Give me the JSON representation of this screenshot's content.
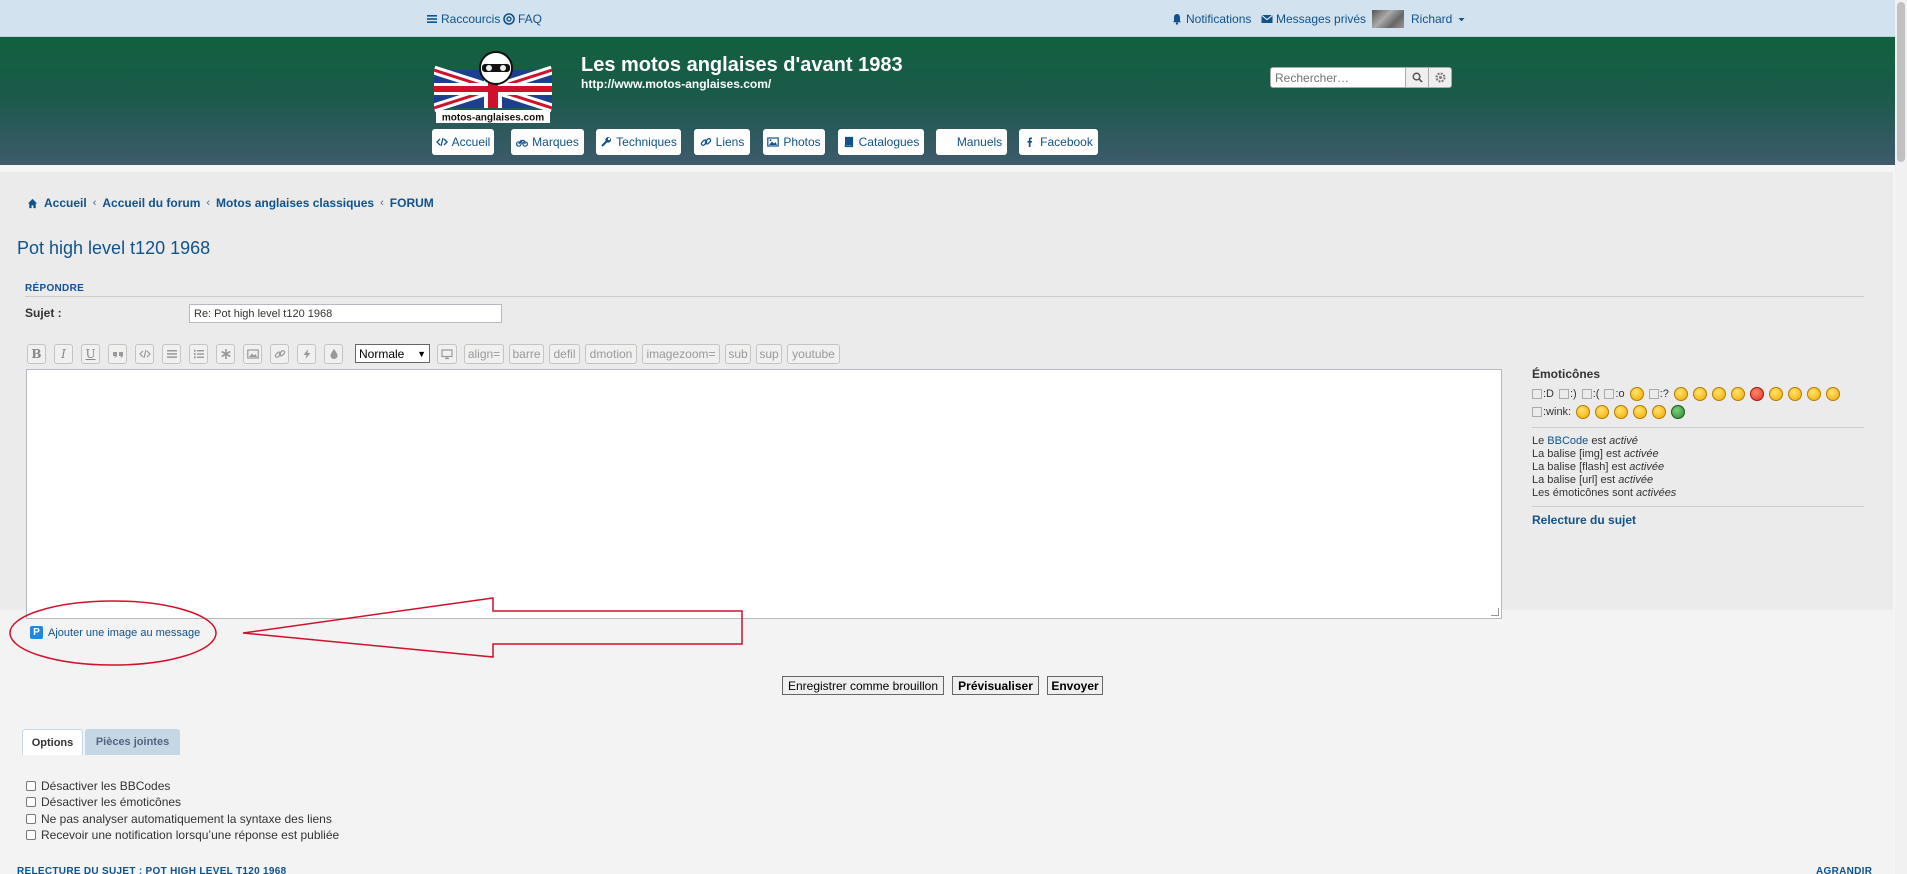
{
  "topbar": {
    "shortcuts": "Raccourcis",
    "faq": "FAQ",
    "notifications": "Notifications",
    "messages": "Messages privés",
    "user": "Richard"
  },
  "site": {
    "logo_text": "motos-anglaises.com",
    "title": "Les motos anglaises d'avant 1983",
    "url": "http://www.motos-anglaises.com/"
  },
  "search": {
    "placeholder": "Rechercher…"
  },
  "nav": [
    {
      "label": "Accueil",
      "icon": "code-icon"
    },
    {
      "label": "Marques",
      "icon": "motorcycle-icon"
    },
    {
      "label": "Techniques",
      "icon": "wrench-icon"
    },
    {
      "label": "Liens",
      "icon": "link-icon"
    },
    {
      "label": "Photos",
      "icon": "image-icon"
    },
    {
      "label": "Catalogues",
      "icon": "book-icon"
    },
    {
      "label": "Manuels",
      "icon": ""
    },
    {
      "label": "Facebook",
      "icon": "facebook-icon"
    }
  ],
  "breadcrumb": [
    "Accueil",
    "Accueil du forum",
    "Motos anglaises classiques",
    "FORUM"
  ],
  "page": {
    "title": "Pot high level t120 1968",
    "section": "RÉPONDRE",
    "subject_label": "Sujet :",
    "subject_value": "Re: Pot high level t120 1968"
  },
  "toolbar": {
    "bold": "B",
    "italic": "I",
    "underline": "U",
    "size_select": "Normale",
    "custom": [
      "align=",
      "barre",
      "defil",
      "dmotion",
      "imagezoom=",
      "sub",
      "sup",
      "youtube"
    ]
  },
  "smilies": {
    "heading": "Émoticônes",
    "broken": [
      ":D",
      ":)",
      ":(",
      ":o",
      ":?",
      ":wink:"
    ]
  },
  "status": {
    "bbcode_pre": "Le ",
    "bbcode_link": "BBCode",
    "bbcode_post": " est ",
    "bbcode_state": "activé",
    "img_pre": "La balise [img] est ",
    "img_state": "activée",
    "flash_pre": "La balise [flash] est ",
    "flash_state": "activée",
    "url_pre": "La balise [url] est ",
    "url_state": "activée",
    "smilies_pre": "Les émoticônes sont ",
    "smilies_state": "activées",
    "topic_review": "Relecture du sujet"
  },
  "add_image": "Ajouter une image au message",
  "buttons": {
    "draft": "Enregistrer comme brouillon",
    "preview": "Prévisualiser",
    "submit": "Envoyer"
  },
  "tabs": {
    "options": "Options",
    "attachments": "Pièces jointes"
  },
  "options": [
    "Désactiver les BBCodes",
    "Désactiver les émoticônes",
    "Ne pas analyser automatiquement la syntaxe des liens",
    "Recevoir une notification lorsqu’une réponse est publiée"
  ],
  "footer": {
    "review": "RELECTURE DU SUJET : POT HIGH LEVEL T120 1968",
    "expand": "AGRANDIR"
  },
  "colors": {
    "link": "#105289",
    "header_top": "#12613e",
    "header_bottom": "#3e5a6c",
    "annotation": "#d0112b"
  }
}
